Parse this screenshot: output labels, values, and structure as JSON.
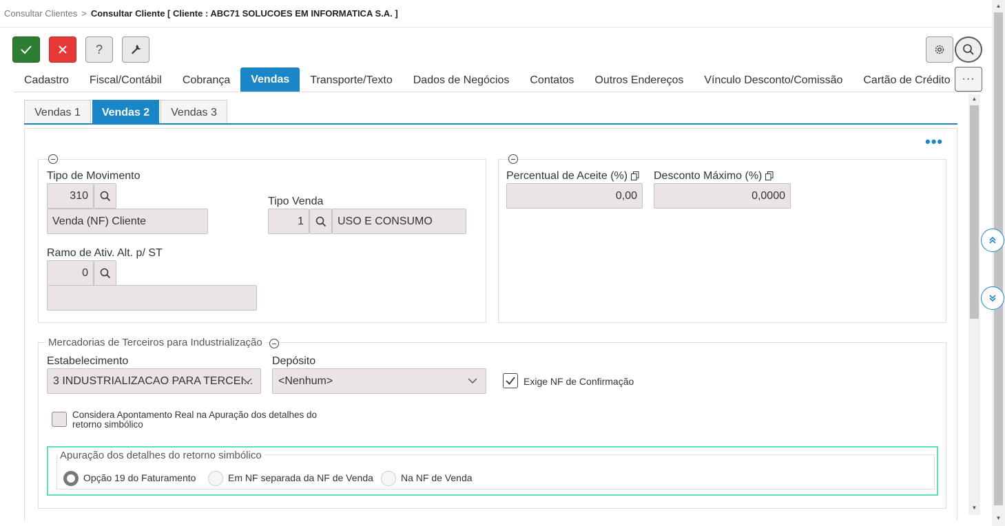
{
  "breadcrumb": {
    "parent": "Consultar Clientes",
    "separator": ">",
    "current": "Consultar Cliente [ Cliente : ABC71 SOLUCOES EM INFORMATICA S.A. ]"
  },
  "toolbar": {
    "confirm_icon": "check-icon",
    "cancel_icon": "close-icon",
    "help_label": "?",
    "tools_icon": "wrench-icon",
    "settings_icon": "gear-icon",
    "search_icon": "search-icon"
  },
  "main_tabs": [
    {
      "label": "Cadastro",
      "active": false
    },
    {
      "label": "Fiscal/Contábil",
      "active": false
    },
    {
      "label": "Cobrança",
      "active": false
    },
    {
      "label": "Vendas",
      "active": true
    },
    {
      "label": "Transporte/Texto",
      "active": false
    },
    {
      "label": "Dados de Negócios",
      "active": false
    },
    {
      "label": "Contatos",
      "active": false
    },
    {
      "label": "Outros Endereços",
      "active": false
    },
    {
      "label": "Vínculo Desconto/Comissão",
      "active": false
    },
    {
      "label": "Cartão de Crédito",
      "active": false
    }
  ],
  "more_tabs_label": "···",
  "sub_tabs": [
    {
      "label": "Vendas 1",
      "active": false
    },
    {
      "label": "Vendas 2",
      "active": true
    },
    {
      "label": "Vendas 3",
      "active": false
    }
  ],
  "content_menu": "•••",
  "section_left": {
    "tipo_movimento": {
      "label": "Tipo de Movimento",
      "code": "310",
      "description": "Venda (NF) Cliente"
    },
    "tipo_venda": {
      "label": "Tipo Venda",
      "code": "1",
      "description": "USO E CONSUMO"
    },
    "ramo_ativ": {
      "label": "Ramo de Ativ. Alt. p/ ST",
      "code": "0",
      "description": ""
    }
  },
  "section_right": {
    "percentual_aceite": {
      "label": "Percentual de Aceite (%)",
      "value": "0,00"
    },
    "desconto_maximo": {
      "label": "Desconto Máximo (%)",
      "value": "0,0000"
    }
  },
  "mercadorias": {
    "legend": "Mercadorias de Terceiros para Industrialização",
    "estabelecimento": {
      "label": "Estabelecimento",
      "value": "3 INDUSTRIALIZACAO PARA TERCEI..."
    },
    "deposito": {
      "label": "Depósito",
      "value": "<Nenhum>"
    },
    "exige_nf": {
      "label": "Exige NF de Confirmação",
      "checked": true
    },
    "considera_apontamento": {
      "label_line1": "Considera Apontamento Real na Apuração dos detalhes do",
      "label_line2": "retorno simbólico",
      "checked": false
    }
  },
  "apuracao": {
    "legend": "Apuração dos detalhes do retorno simbólico",
    "options": [
      {
        "label": "Opção 19 do Faturamento",
        "selected": true
      },
      {
        "label": "Em NF separada da NF de Venda",
        "selected": false
      },
      {
        "label": "Na NF de Venda",
        "selected": false
      }
    ]
  },
  "colors": {
    "accent": "#1a86c8",
    "confirm": "#2e7d32",
    "cancel": "#e53935",
    "input_bg": "#ebe4e4",
    "highlight_border": "#5fe0b8"
  }
}
